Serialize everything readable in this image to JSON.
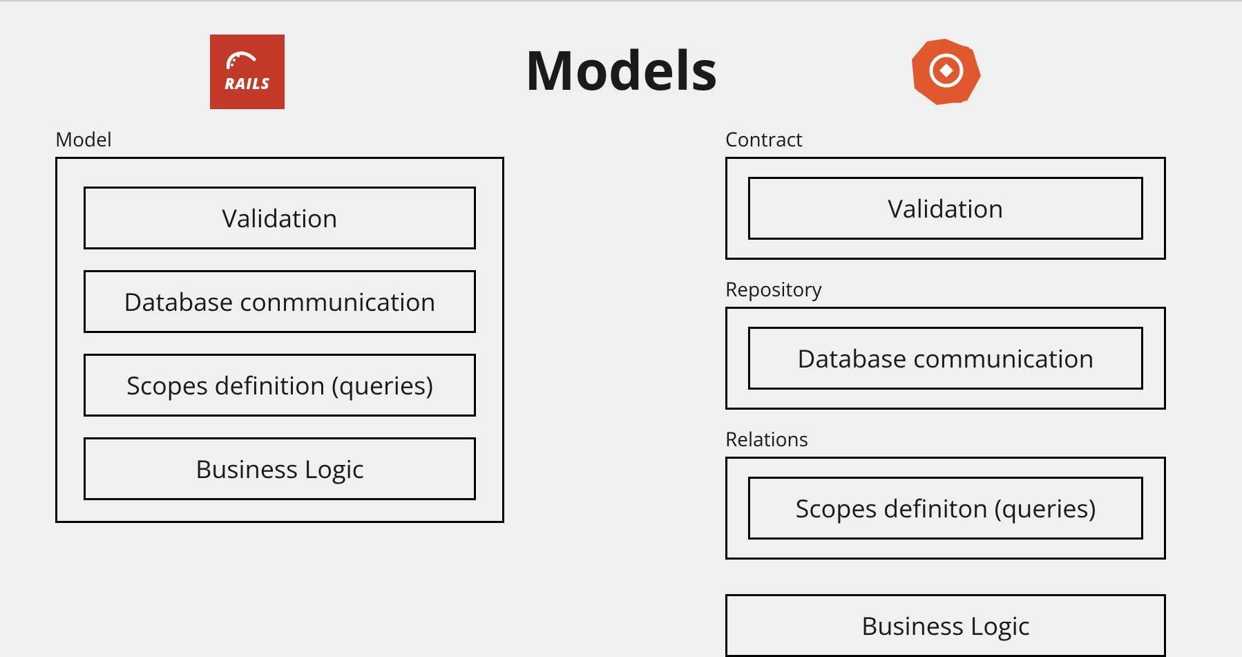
{
  "title": "Models",
  "logos": {
    "rails": "RAILS",
    "hanami": "hanami"
  },
  "left": {
    "label": "Model",
    "items": [
      "Validation",
      "Database conmmunication",
      "Scopes definition (queries)",
      "Business Logic"
    ]
  },
  "right": {
    "groups": [
      {
        "label": "Contract",
        "item": "Validation"
      },
      {
        "label": "Repository",
        "item": "Database communication"
      },
      {
        "label": "Relations",
        "item": "Scopes definiton (queries)"
      }
    ],
    "standalone": "Business Logic"
  }
}
